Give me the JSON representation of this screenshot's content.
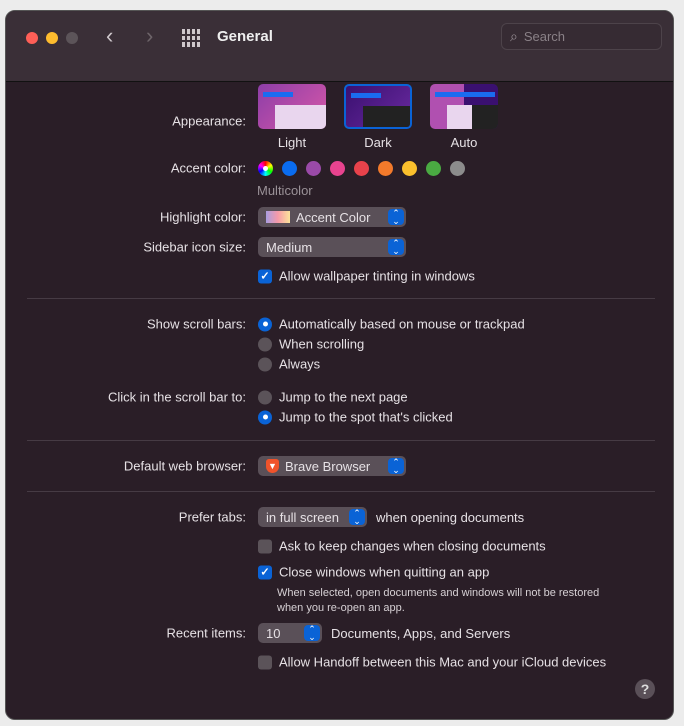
{
  "window": {
    "title": "General",
    "search_placeholder": "Search"
  },
  "appearance": {
    "label": "Appearance:",
    "options": [
      "Light",
      "Dark",
      "Auto"
    ],
    "selected": "Dark"
  },
  "accent": {
    "label": "Accent color:",
    "selected_name": "Multicolor",
    "colors": [
      "multicolor",
      "#0a6cf0",
      "#9a4aa8",
      "#e8438f",
      "#e8424b",
      "#f37a2b",
      "#fbc02d",
      "#4aaa42",
      "#8c8c8c"
    ]
  },
  "highlight": {
    "label": "Highlight color:",
    "value": "Accent Color"
  },
  "sidebar_icon": {
    "label": "Sidebar icon size:",
    "value": "Medium"
  },
  "wallpaper_tinting": {
    "label": "Allow wallpaper tinting in windows",
    "checked": true
  },
  "scroll_bars": {
    "label": "Show scroll bars:",
    "options": [
      "Automatically based on mouse or trackpad",
      "When scrolling",
      "Always"
    ],
    "selected": 0
  },
  "click_scroll": {
    "label": "Click in the scroll bar to:",
    "options": [
      "Jump to the next page",
      "Jump to the spot that's clicked"
    ],
    "selected": 1
  },
  "browser": {
    "label": "Default web browser:",
    "value": "Brave Browser"
  },
  "prefer_tabs": {
    "label": "Prefer tabs:",
    "value": "in full screen",
    "suffix": "when opening documents"
  },
  "ask_keep": {
    "label": "Ask to keep changes when closing documents",
    "checked": false
  },
  "close_windows": {
    "label": "Close windows when quitting an app",
    "checked": true,
    "note1": "When selected, open documents and windows will not be restored",
    "note2": "when you re-open an app."
  },
  "recent": {
    "label": "Recent items:",
    "value": "10",
    "suffix": "Documents, Apps, and Servers"
  },
  "handoff": {
    "label": "Allow Handoff between this Mac and your iCloud devices",
    "checked": false
  },
  "help": "?"
}
